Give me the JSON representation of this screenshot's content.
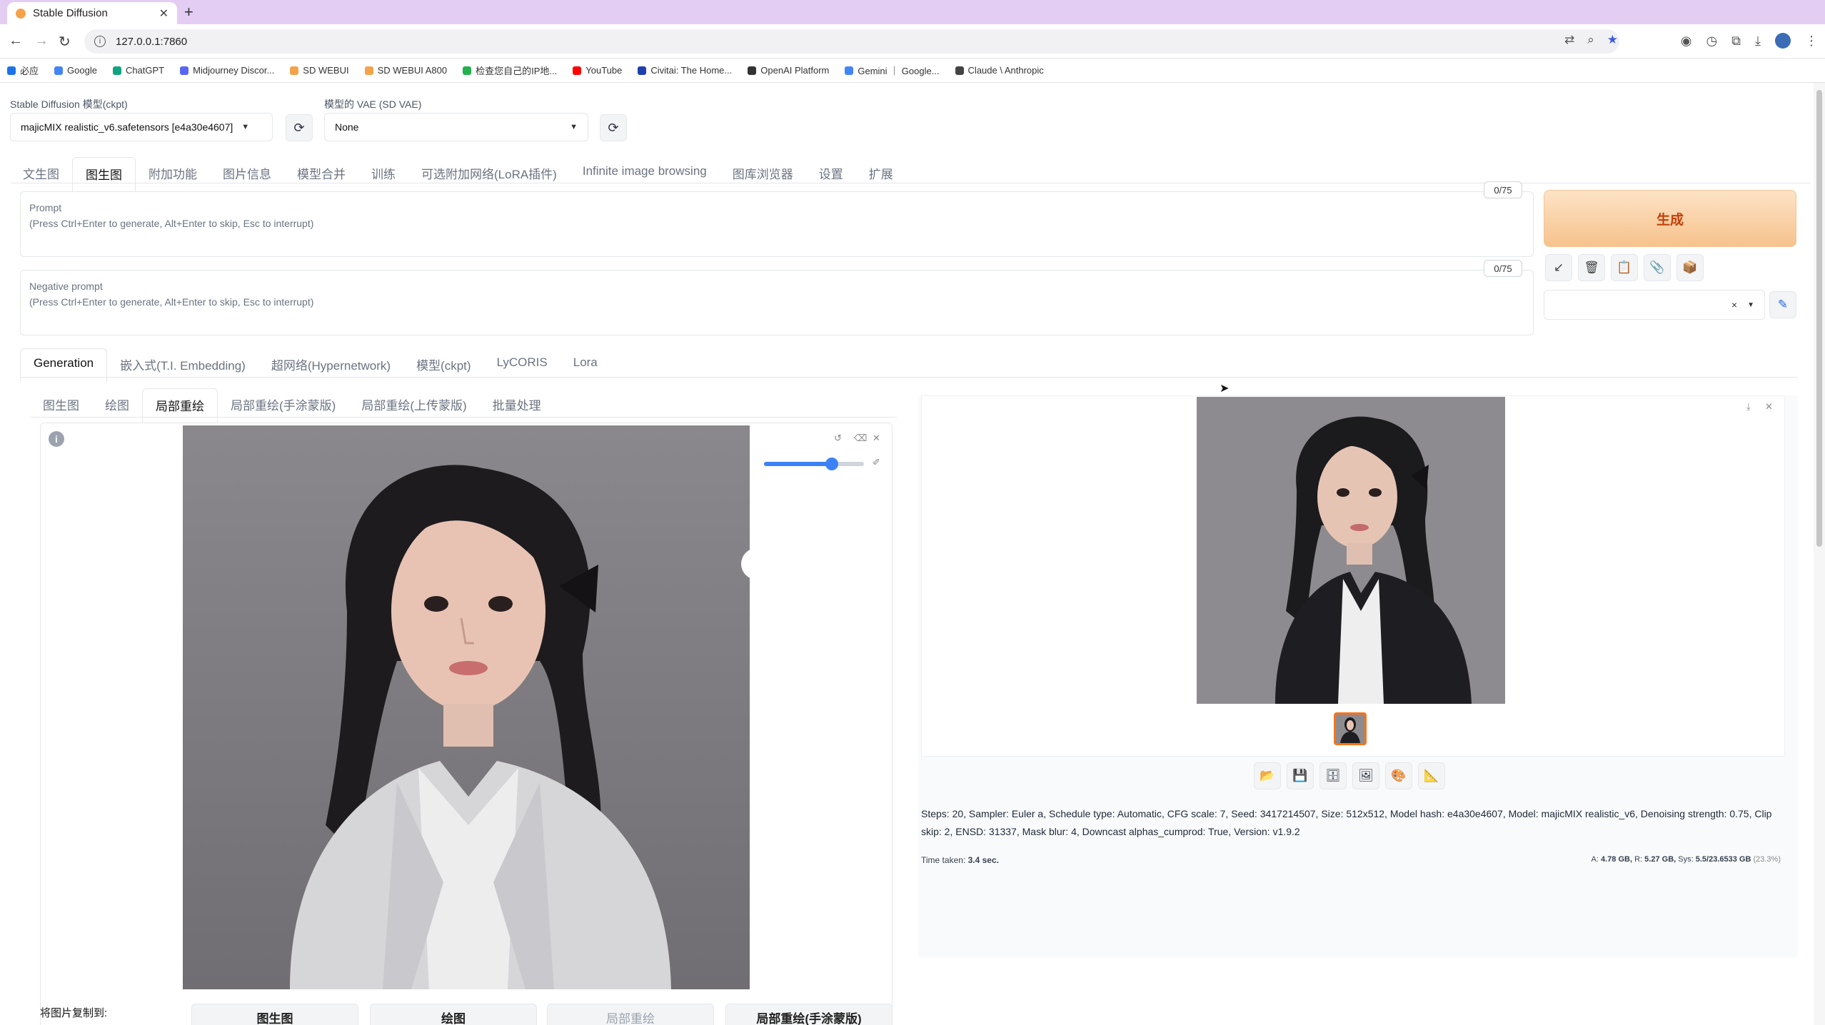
{
  "browser": {
    "tab_title": "Stable Diffusion",
    "url": "127.0.0.1:7860",
    "bookmarks": [
      {
        "label": "必应",
        "color": "#1a73e8"
      },
      {
        "label": "Google",
        "color": "#4285f4"
      },
      {
        "label": "ChatGPT",
        "color": "#10a37f"
      },
      {
        "label": "Midjourney Discor...",
        "color": "#5865f2"
      },
      {
        "label": "SD WEBUI",
        "color": "#f4a34a"
      },
      {
        "label": "SD WEBUI A800",
        "color": "#f4a34a"
      },
      {
        "label": "检查您自己的IP地...",
        "color": "#22b14c"
      },
      {
        "label": "YouTube",
        "color": "#ff0000"
      },
      {
        "label": "Civitai: The Home...",
        "color": "#1e40af"
      },
      {
        "label": "OpenAI Platform",
        "color": "#333333"
      },
      {
        "label": "Gemini ｜ Google...",
        "color": "#4285f4"
      },
      {
        "label": "Claude \\ Anthropic",
        "color": "#444444"
      }
    ]
  },
  "model": {
    "ckpt_label": "Stable Diffusion 模型(ckpt)",
    "ckpt_value": "majicMIX realistic_v6.safetensors [e4a30e4607]",
    "vae_label": "模型的 VAE (SD VAE)",
    "vae_value": "None"
  },
  "main_tabs": [
    "文生图",
    "图生图",
    "附加功能",
    "图片信息",
    "模型合并",
    "训练",
    "可选附加网络(LoRA插件)",
    "Infinite image browsing",
    "图库浏览器",
    "设置",
    "扩展"
  ],
  "prompt": {
    "label": "Prompt",
    "placeholder": "(Press Ctrl+Enter to generate, Alt+Enter to skip, Esc to interrupt)",
    "counter": "0/75"
  },
  "negative_prompt": {
    "label": "Negative prompt",
    "placeholder": "(Press Ctrl+Enter to generate, Alt+Enter to skip, Esc to interrupt)",
    "counter": "0/75"
  },
  "generate_label": "生成",
  "style_clear": "×",
  "network_tabs": [
    "Generation",
    "嵌入式(T.I. Embedding)",
    "超网络(Hypernetwork)",
    "模型(ckpt)",
    "LyCORIS",
    "Lora"
  ],
  "img2img_tabs": [
    "图生图",
    "绘图",
    "局部重绘",
    "局部重绘(手涂蒙版)",
    "局部重绘(上传蒙版)",
    "批量处理"
  ],
  "brush": {
    "size_fraction": 0.68
  },
  "output": {
    "params": "Steps: 20, Sampler: Euler a, Schedule type: Automatic, CFG scale: 7, Seed: 3417214507, Size: 512x512, Model hash: e4a30e4607, Model: majicMIX realistic_v6, Denoising strength: 0.75, Clip skip: 2, ENSD: 31337, Mask blur: 4, Downcast alphas_cumprod: True, Version: v1.9.2",
    "time_label": "Time taken:",
    "time_value": "3.4 sec.",
    "vram_a_label": "A:",
    "vram_a": "4.78 GB,",
    "vram_r_label": "R:",
    "vram_r": "5.27 GB,",
    "vram_sys_label": "Sys:",
    "vram_sys": "5.5/23.6533 GB",
    "vram_pct": "(23.3%)"
  },
  "copy_to": {
    "label": "将图片复制到:",
    "buttons": [
      "图生图",
      "绘图",
      "局部重绘",
      "局部重绘(手涂蒙版)"
    ]
  }
}
